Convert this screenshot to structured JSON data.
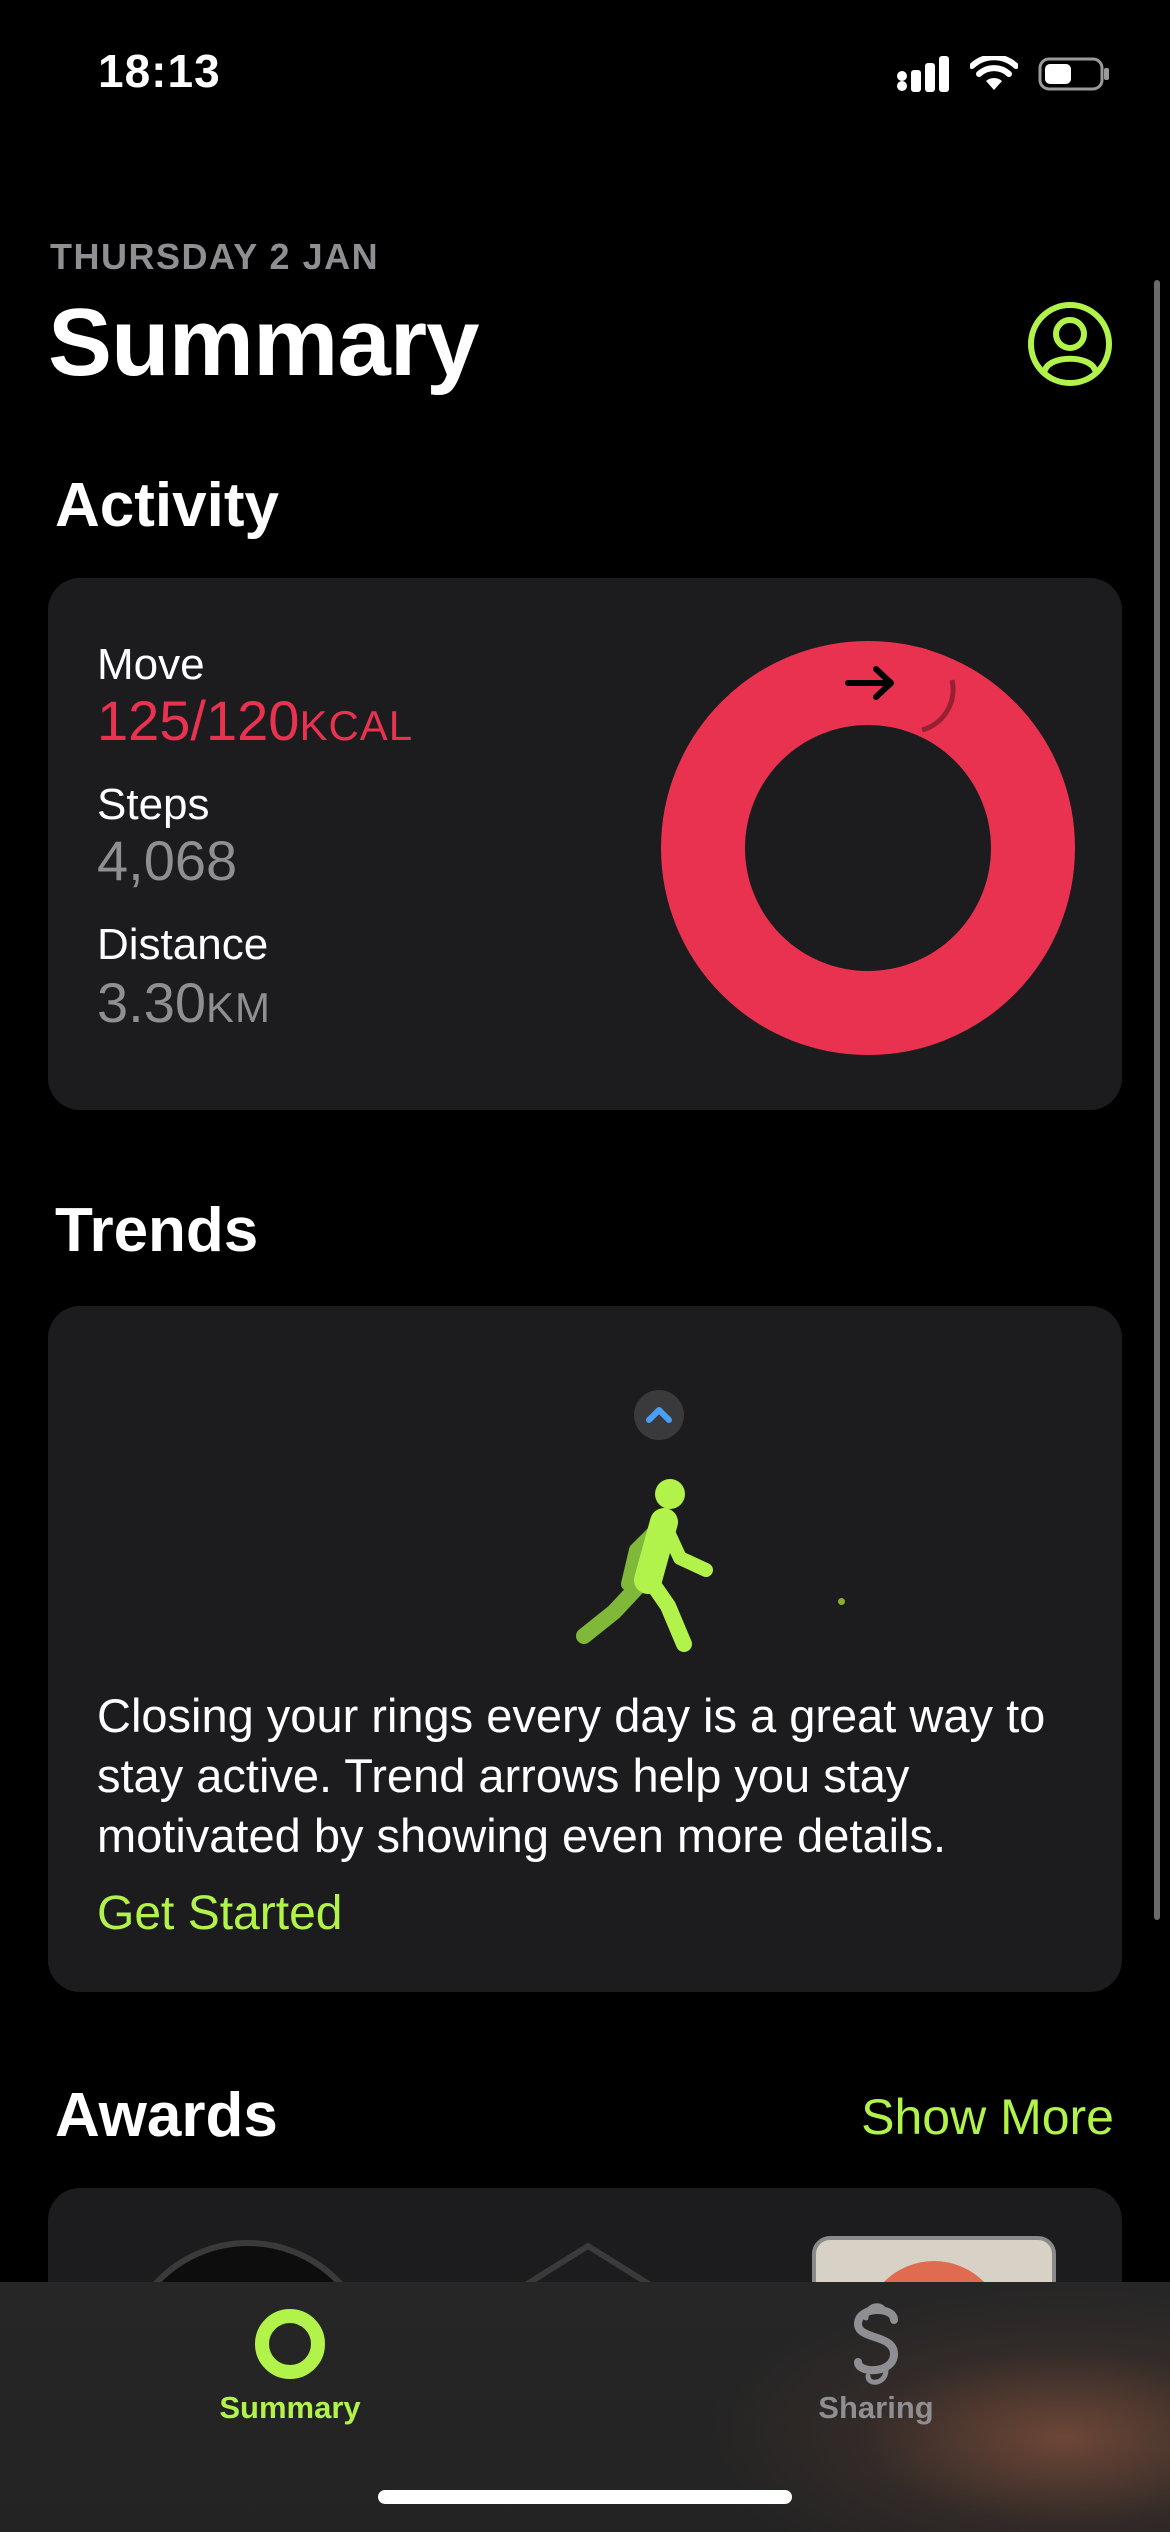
{
  "status_bar": {
    "time": "18:13",
    "battery_level": 0.5
  },
  "header": {
    "date": "THURSDAY 2 JAN",
    "title": "Summary"
  },
  "activity": {
    "section_title": "Activity",
    "move": {
      "label": "Move",
      "value": "125/120",
      "unit": "KCAL",
      "ring_progress": 1.04,
      "color": "#e9324f"
    },
    "steps": {
      "label": "Steps",
      "value": "4,068"
    },
    "distance": {
      "label": "Distance",
      "value": "3.30",
      "unit": "KM"
    }
  },
  "trends": {
    "section_title": "Trends",
    "text": "Closing your rings every day is a great way to stay active. Trend arrows help you stay motivated by showing even more details.",
    "link": "Get Started"
  },
  "awards": {
    "section_title": "Awards",
    "show_more": "Show More"
  },
  "tab_bar": {
    "tabs": [
      {
        "label": "Summary",
        "icon": "activity-ring-icon",
        "selected": true
      },
      {
        "label": "Sharing",
        "icon": "sharing-icon",
        "selected": false
      }
    ]
  },
  "colors": {
    "accent": "#b1f34a",
    "move": "#e9324f",
    "card": "#1c1c1e",
    "secondary_text": "#8e8e93"
  }
}
